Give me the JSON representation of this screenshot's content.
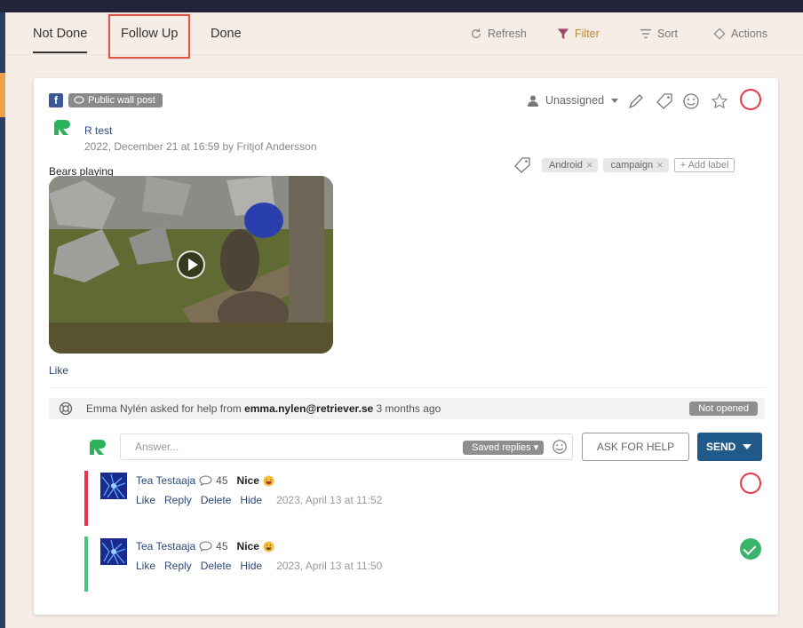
{
  "tabs": {
    "not_done": "Not Done",
    "follow_up": "Follow Up",
    "done": "Done"
  },
  "toolbar": {
    "refresh": "Refresh",
    "filter": "Filter",
    "sort": "Sort",
    "actions": "Actions"
  },
  "post": {
    "source_icon": "facebook-icon",
    "type_badge": "Public wall post",
    "author": "R test",
    "meta": "2022, December 21 at 16:59 by Fritjof Andersson",
    "assignee": "Unassigned",
    "message": "Bears playing",
    "labels": [
      "Android",
      "campaign"
    ],
    "add_label": "Add label",
    "like": "Like"
  },
  "help": {
    "prefix": "Emma Nylén asked for help from",
    "email": "emma.nylen@retriever.se",
    "suffix": "3 months ago",
    "status": "Not opened"
  },
  "composer": {
    "placeholder": "Answer...",
    "saved_replies": "Saved replies",
    "ask_for_help": "ASK FOR HELP",
    "send": "SEND"
  },
  "replies": [
    {
      "name": "Tea Testaaja",
      "count": "45",
      "message": "Nice",
      "actions": [
        "Like",
        "Reply",
        "Delete",
        "Hide"
      ],
      "timestamp": "2023, April 13 at 11:52",
      "status": "open",
      "bar_color": "#e8344d"
    },
    {
      "name": "Tea Testaaja",
      "count": "45",
      "message": "Nice",
      "actions": [
        "Like",
        "Reply",
        "Delete",
        "Hide"
      ],
      "timestamp": "2023, April 13 at 11:50",
      "status": "done",
      "bar_color": "#49c47a"
    }
  ],
  "colors": {
    "accent": "#1f5a8a",
    "open_status": "#e8344d",
    "done_status": "#3ab36b",
    "filter": "#b48a35"
  }
}
